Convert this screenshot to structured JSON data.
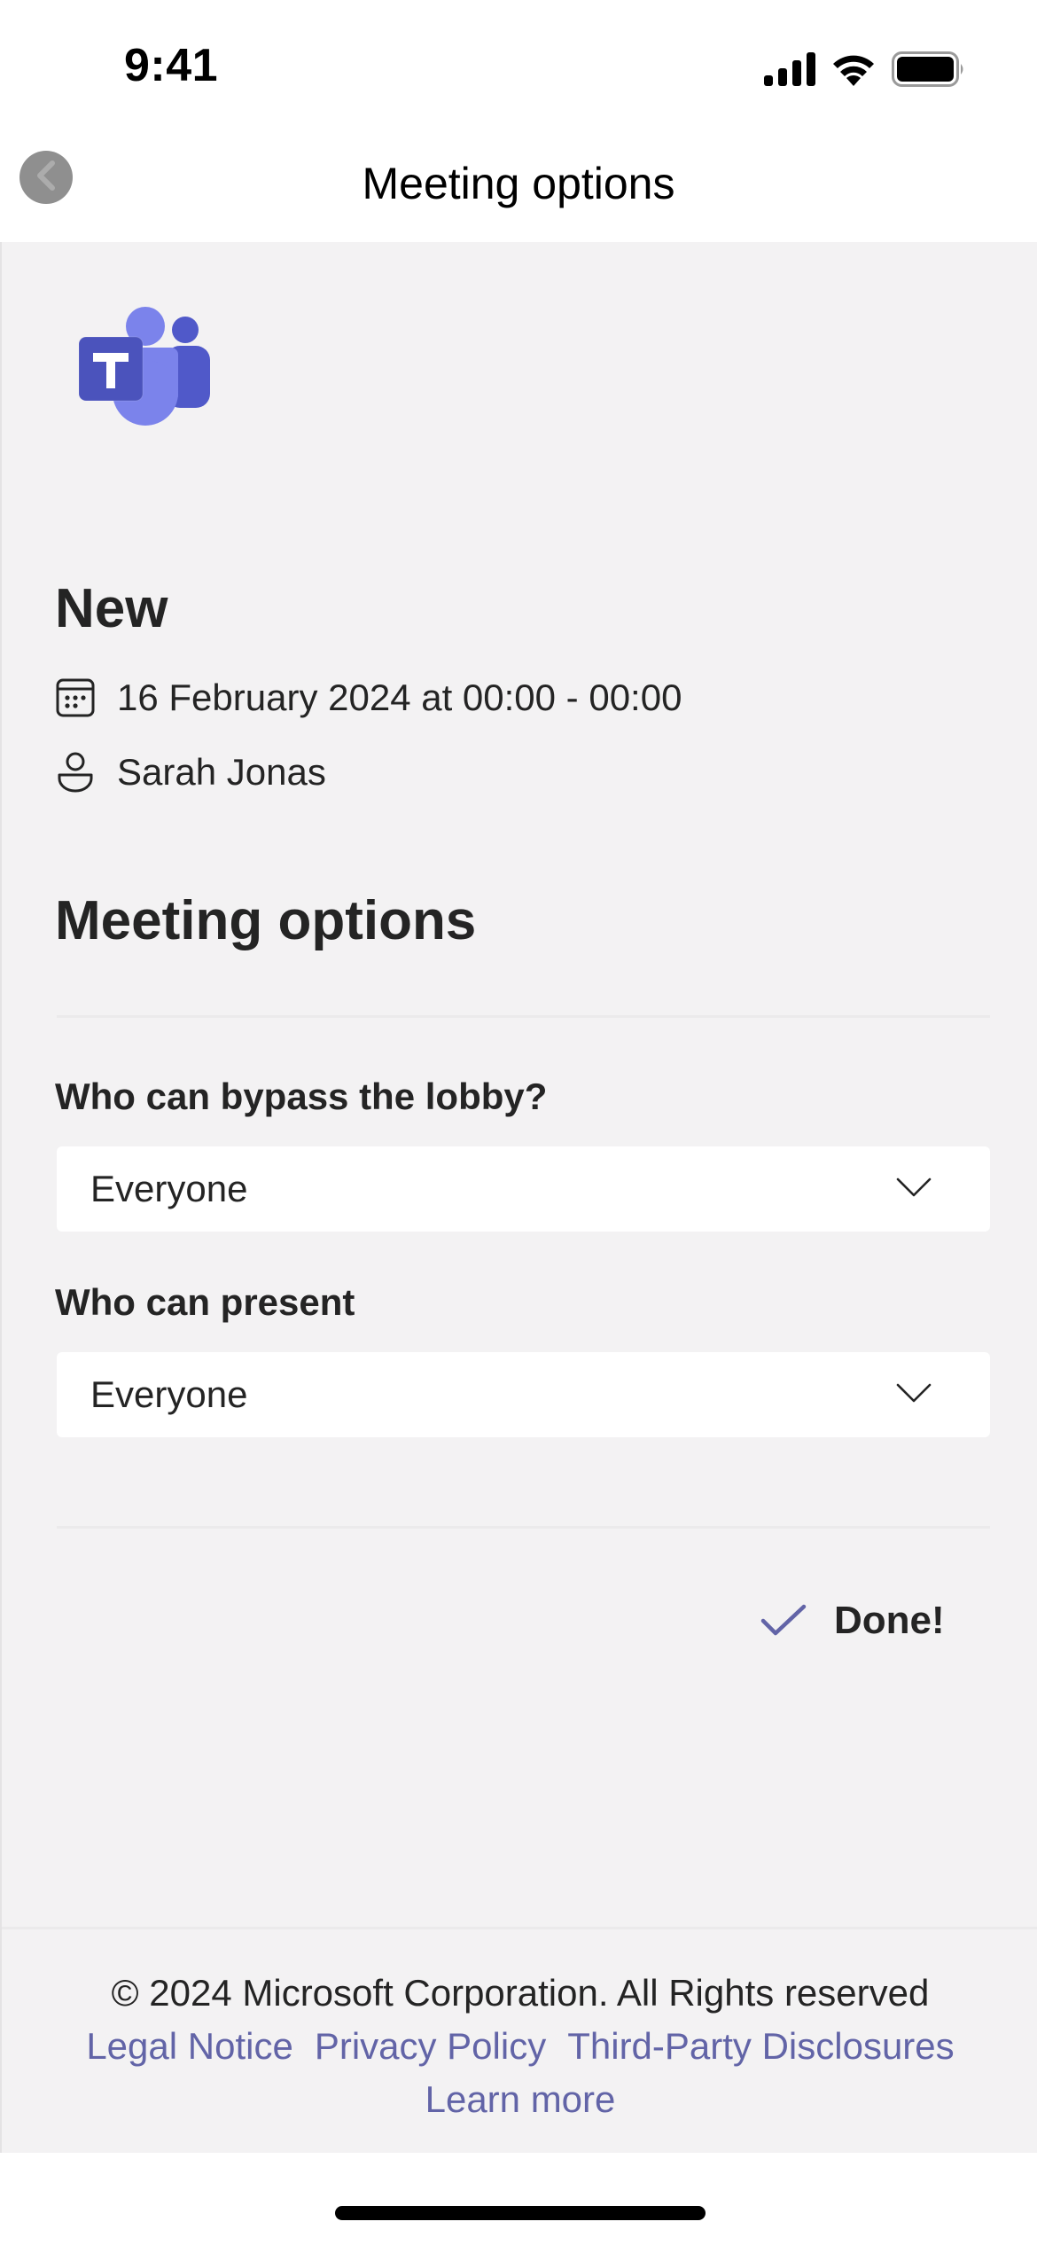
{
  "status_bar": {
    "time": "9:41",
    "icons": [
      "cellular-signal-icon",
      "wifi-icon",
      "battery-icon"
    ]
  },
  "nav": {
    "title": "Meeting options",
    "back_icon": "back-chevron-icon"
  },
  "meeting": {
    "logo": "microsoft-teams-logo",
    "title": "New",
    "date_icon": "calendar-icon",
    "date": "16 February 2024 at 00:00 - 00:00",
    "organizer_icon": "person-icon",
    "organizer": "Sarah Jonas"
  },
  "options": {
    "section_title": "Meeting options",
    "fields": [
      {
        "label": "Who can bypass the lobby?",
        "value": "Everyone"
      },
      {
        "label": "Who can present",
        "value": "Everyone"
      }
    ],
    "done_icon": "checkmark-icon",
    "done_label": "Done!"
  },
  "footer": {
    "copyright": "© 2024 Microsoft Corporation. All Rights reserved",
    "links": [
      "Legal Notice",
      "Privacy Policy",
      "Third-Party Disclosures",
      "Learn more"
    ]
  },
  "colors": {
    "accent": "#6264a7",
    "page_background": "#f3f2f3",
    "teams_dark": "#4b53bc",
    "teams_light": "#7b83eb"
  }
}
